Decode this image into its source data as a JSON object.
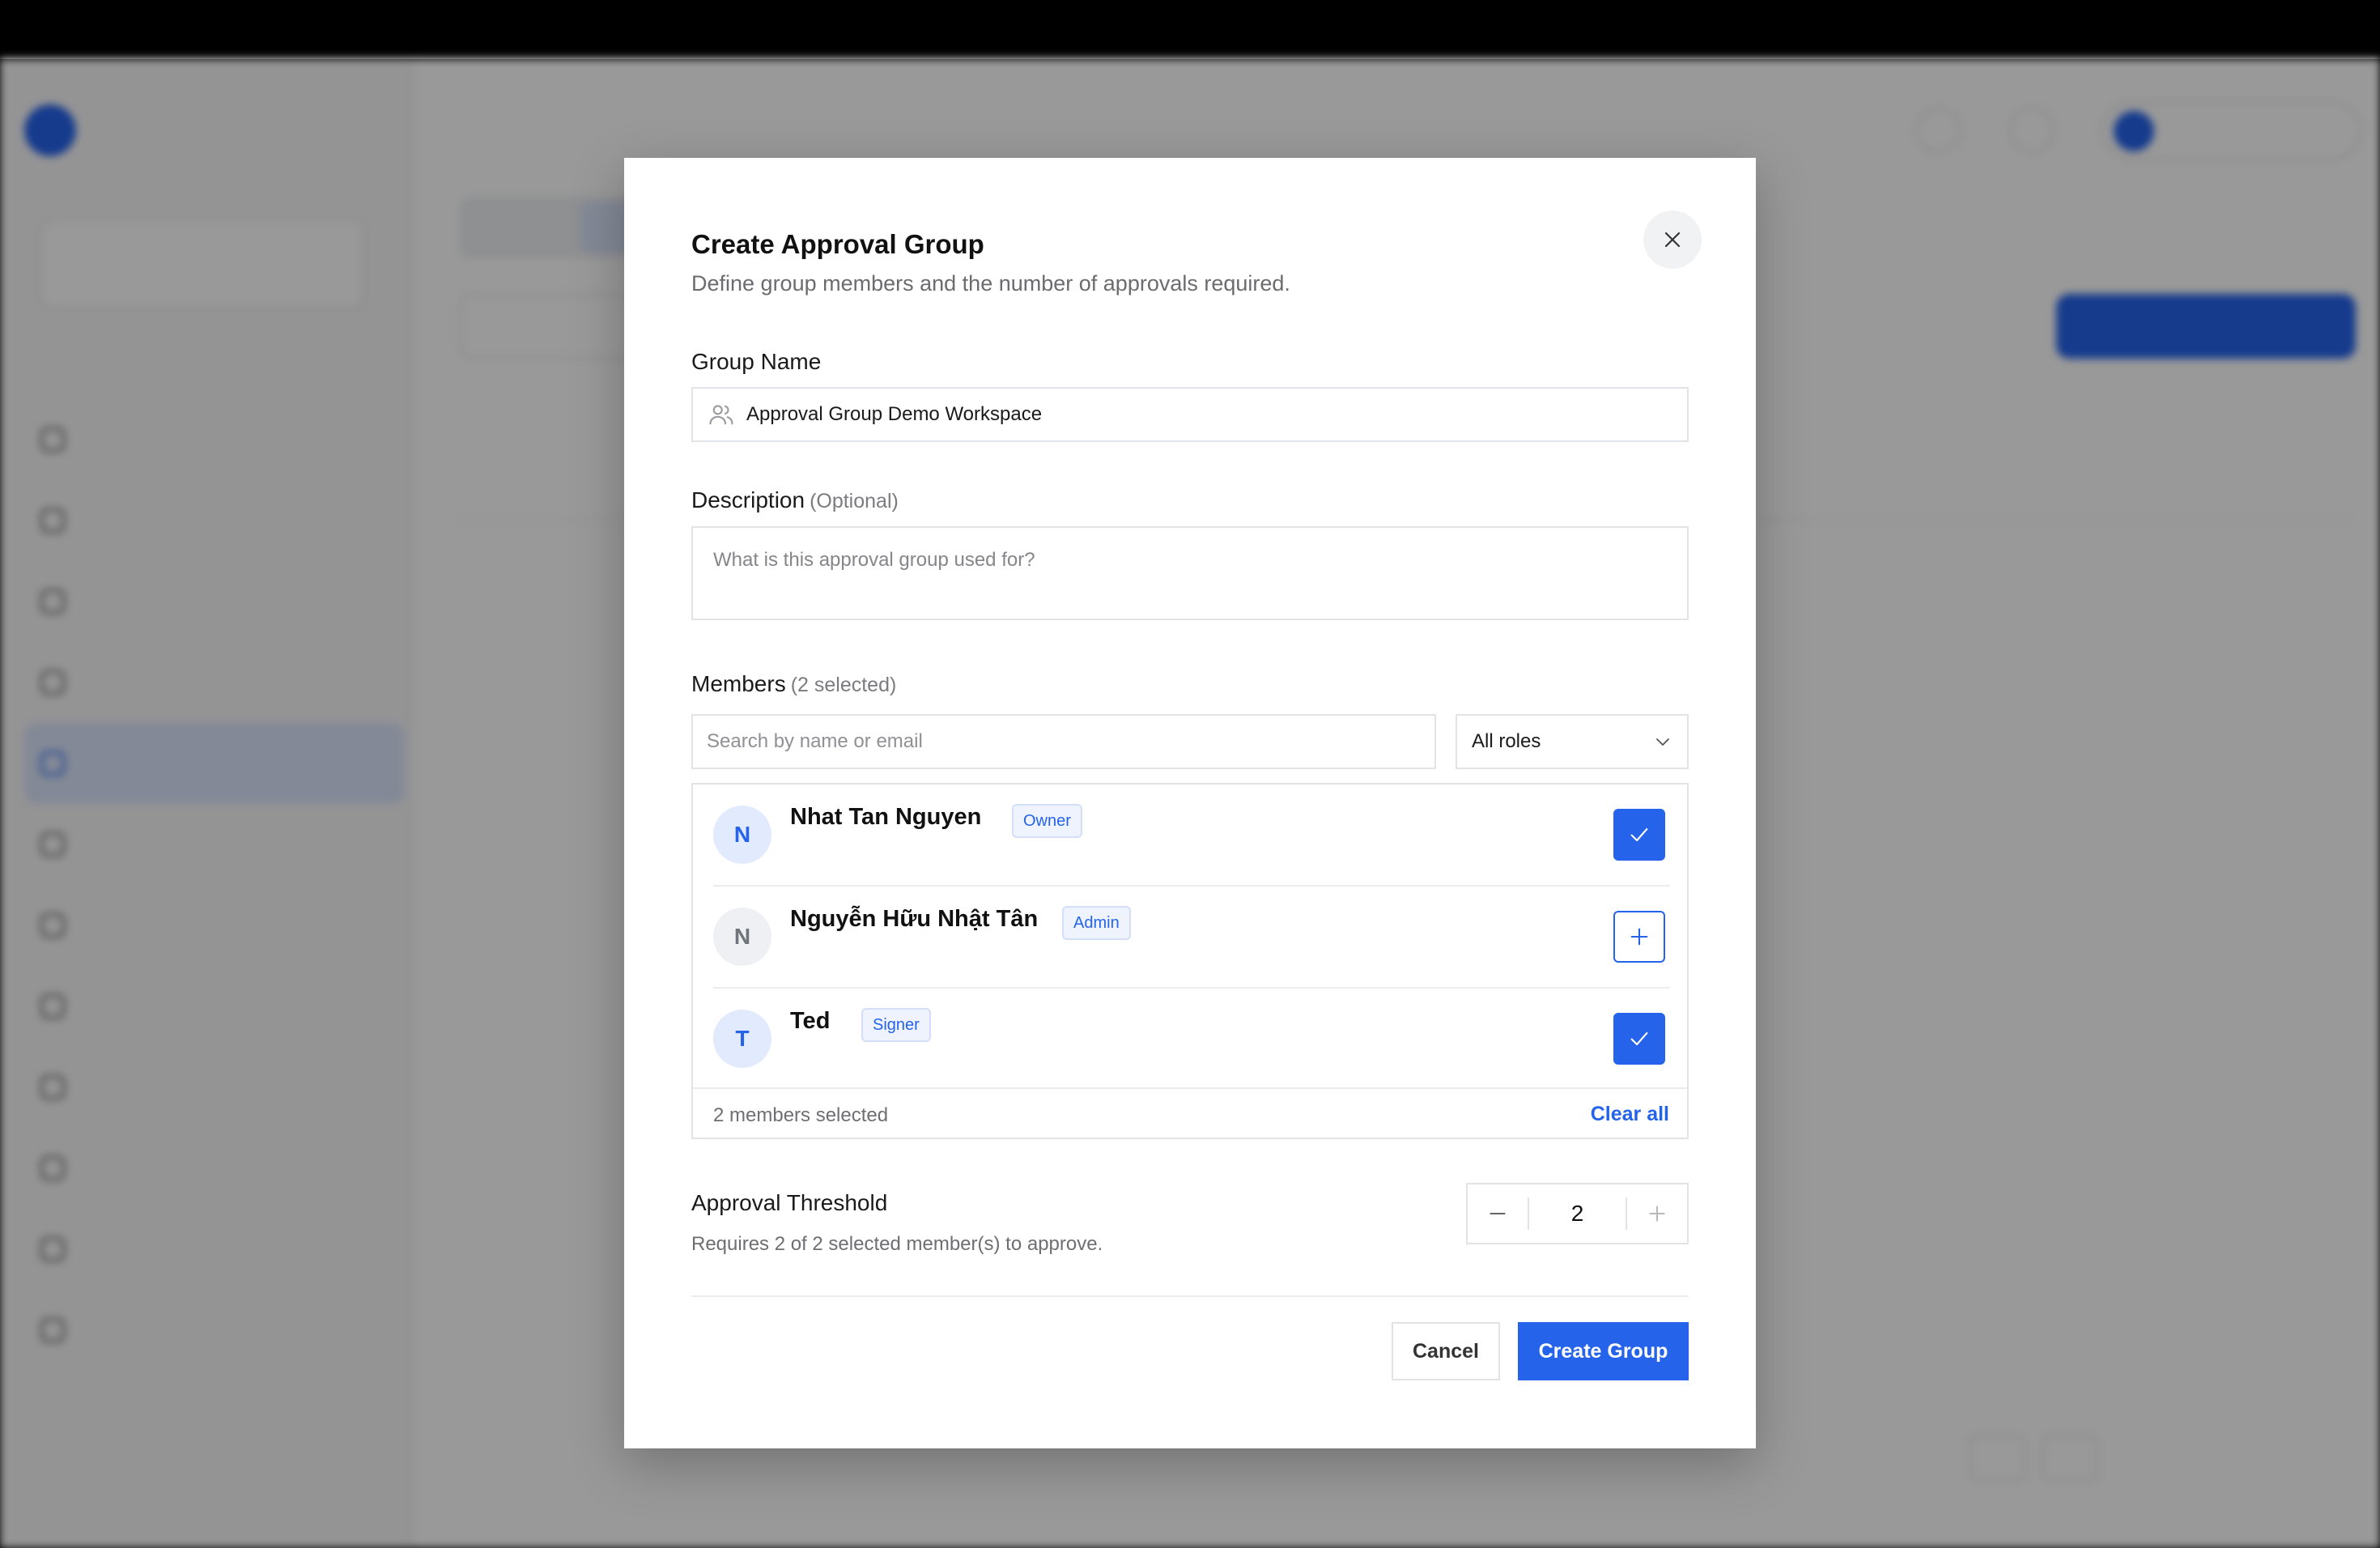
{
  "modal": {
    "title": "Create Approval Group",
    "subtitle": "Define group members and the number of approvals required.",
    "group_name": {
      "label": "Group Name",
      "value": "Approval Group Demo Workspace"
    },
    "description": {
      "label": "Description",
      "optional": "(Optional)",
      "placeholder": "What is this approval group used for?"
    },
    "members": {
      "label": "Members",
      "count_note": "(2 selected)",
      "search_placeholder": "Search by name or email",
      "role_filter": "All roles",
      "list": [
        {
          "initial": "N",
          "name": "Nhat Tan Nguyen",
          "role": "Owner",
          "selected": true
        },
        {
          "initial": "N",
          "name": "Nguyễn Hữu Nhật Tân",
          "role": "Admin",
          "selected": false
        },
        {
          "initial": "T",
          "name": "Ted",
          "role": "Signer",
          "selected": true
        }
      ],
      "selected_summary": "2 members selected",
      "clear_all": "Clear all"
    },
    "threshold": {
      "title": "Approval Threshold",
      "description": "Requires 2 of 2 selected member(s) to approve.",
      "value": "2"
    },
    "cancel_label": "Cancel",
    "create_label": "Create Group"
  },
  "colors": {
    "accent": "#2563eb",
    "overlay": "rgba(0,0,0,0.40)"
  },
  "icons": [
    "close-icon",
    "users-icon",
    "chevron-down-icon",
    "check-icon",
    "plus-icon",
    "minus-icon"
  ]
}
